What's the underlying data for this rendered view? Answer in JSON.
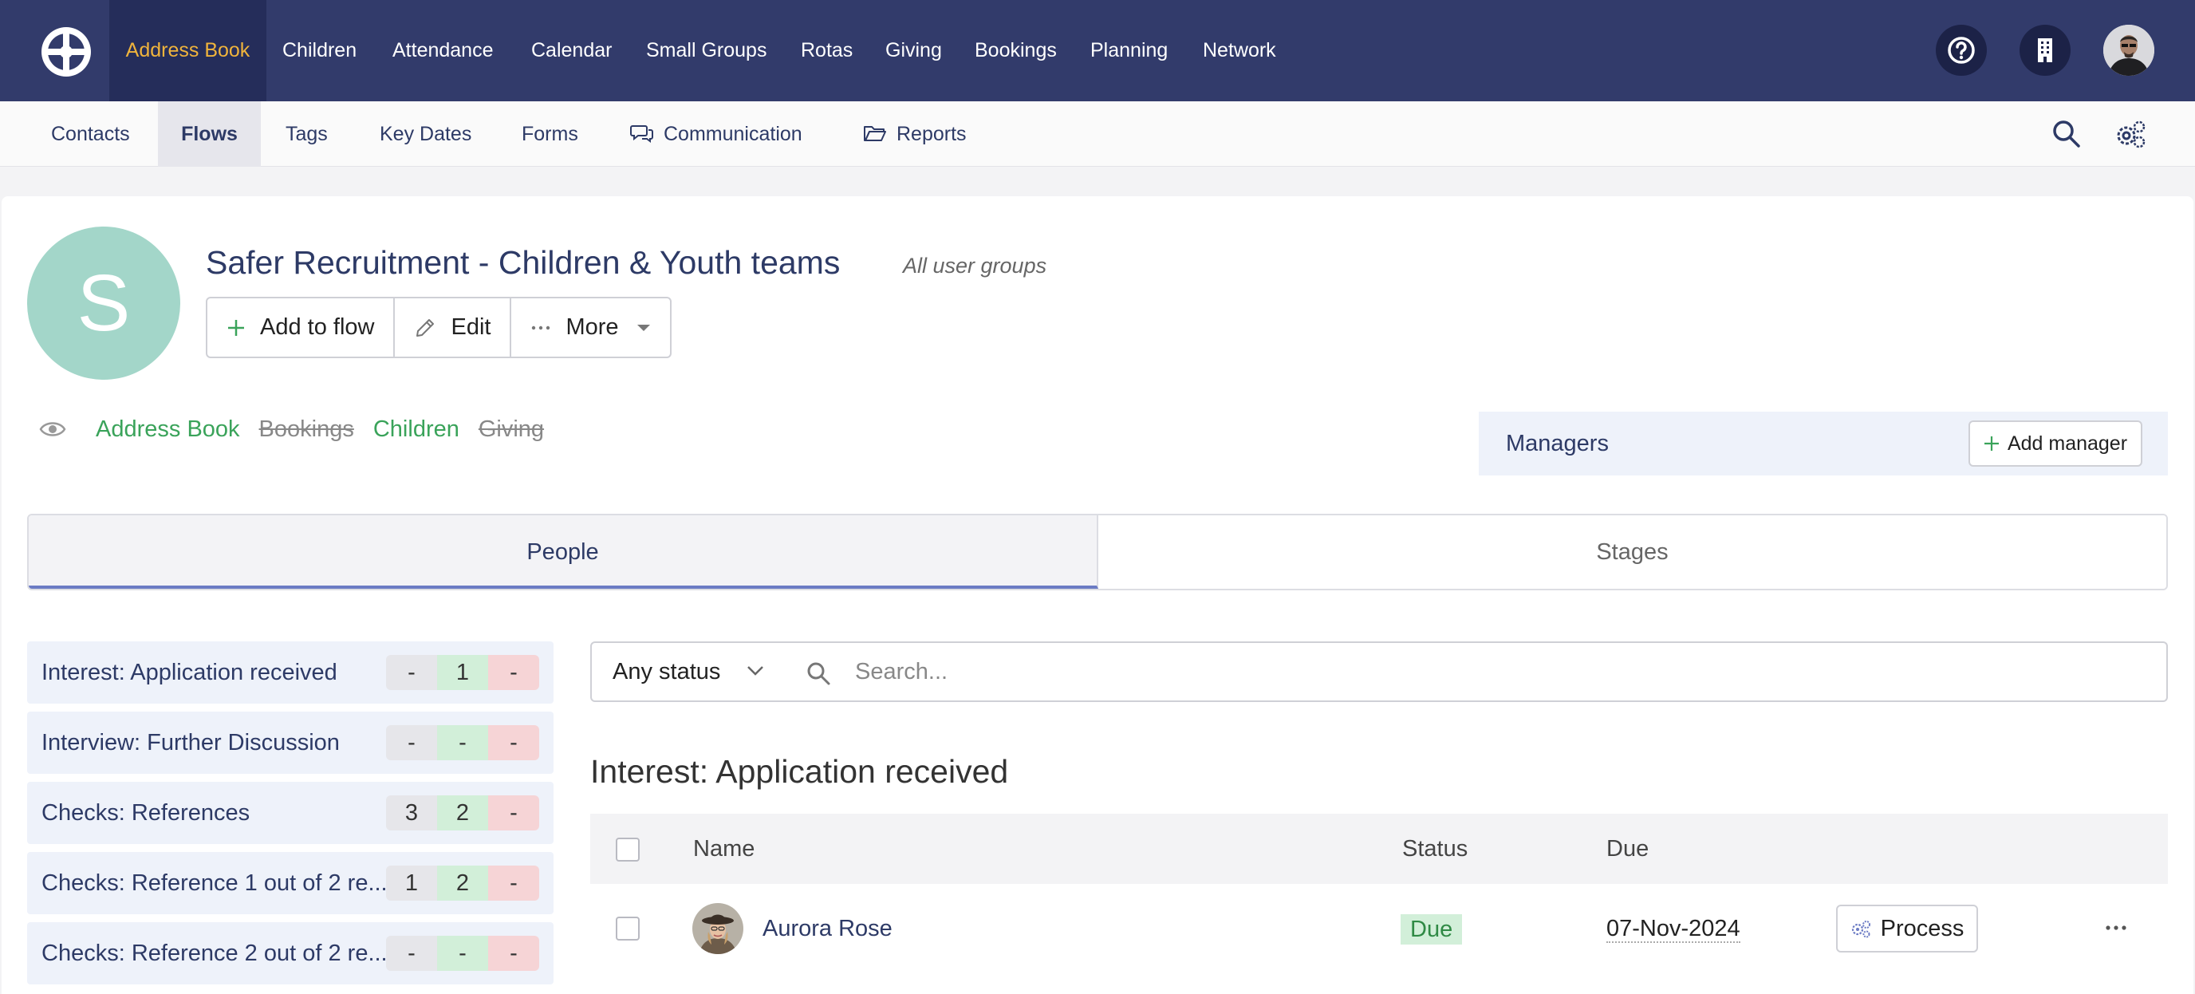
{
  "topnav": {
    "items": [
      "Address Book",
      "Children",
      "Attendance",
      "Calendar",
      "Small Groups",
      "Rotas",
      "Giving",
      "Bookings",
      "Planning",
      "Network"
    ],
    "active": "Address Book"
  },
  "subnav": {
    "items": [
      "Contacts",
      "Flows",
      "Tags",
      "Key Dates",
      "Forms",
      "Communication",
      "Reports"
    ],
    "active": "Flows"
  },
  "flow": {
    "avatar_letter": "S",
    "title": "Safer Recruitment - Children & Youth teams",
    "groups": "All user groups",
    "actions": {
      "add": "Add to flow",
      "edit": "Edit",
      "more": "More"
    }
  },
  "visibility": {
    "modules": [
      {
        "label": "Address Book",
        "enabled": true
      },
      {
        "label": "Bookings",
        "enabled": false
      },
      {
        "label": "Children",
        "enabled": true
      },
      {
        "label": "Giving",
        "enabled": false
      }
    ]
  },
  "managers": {
    "label": "Managers",
    "add_label": "Add manager"
  },
  "tabs": {
    "people": "People",
    "stages": "Stages",
    "active": "People"
  },
  "stages": [
    {
      "name": "Interest: Application received",
      "counts": [
        "-",
        "1",
        "-"
      ]
    },
    {
      "name": "Interview: Further Discussion",
      "counts": [
        "-",
        "-",
        "-"
      ]
    },
    {
      "name": "Checks: References",
      "counts": [
        "3",
        "2",
        "-"
      ]
    },
    {
      "name": "Checks: Reference 1 out of 2 re...",
      "counts": [
        "1",
        "2",
        "-"
      ]
    },
    {
      "name": "Checks: Reference 2 out of 2 re...",
      "counts": [
        "-",
        "-",
        "-"
      ]
    }
  ],
  "filter": {
    "status": "Any status",
    "search_placeholder": "Search..."
  },
  "section": {
    "title": "Interest: Application received"
  },
  "table": {
    "headers": {
      "name": "Name",
      "status": "Status",
      "due": "Due"
    },
    "rows": [
      {
        "name": "Aurora Rose",
        "status": "Due",
        "due": "07-Nov-2024",
        "action": "Process"
      }
    ]
  },
  "colors": {
    "nav_bg": "#323b6b",
    "nav_active_text": "#f0b43c",
    "accent_green": "#3aa35a",
    "avatar_bg": "#a3d6c9"
  }
}
